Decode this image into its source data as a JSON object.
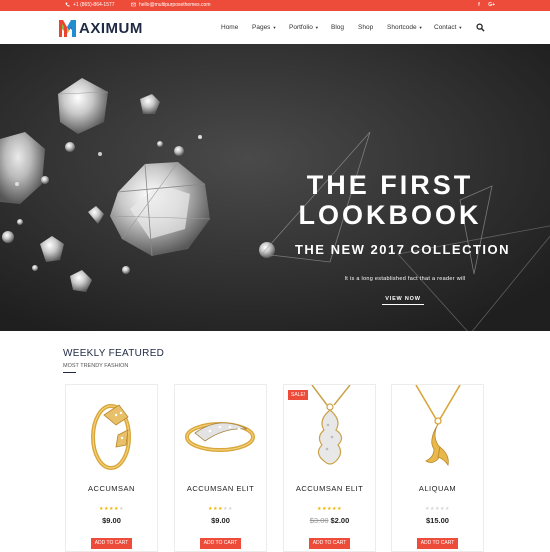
{
  "topbar": {
    "phone": "+1 (865)-864-1577",
    "email": "hello@multipurposethemes.com",
    "social": [
      "f",
      "G+"
    ]
  },
  "header": {
    "logo_text": "AXIMUM",
    "nav": [
      {
        "label": "Home"
      },
      {
        "label": "Pages"
      },
      {
        "label": "Portfolio"
      },
      {
        "label": "Blog"
      },
      {
        "label": "Shop"
      },
      {
        "label": "Shortcode"
      },
      {
        "label": "Contact"
      }
    ]
  },
  "hero": {
    "title": "THE FIRST LOOKBOOK",
    "subtitle": "THE NEW 2017 COLLECTION",
    "description": "It is a long established fact that a reader will",
    "button": "VIEW NOW"
  },
  "featured": {
    "title": "WEEKLY FEATURED",
    "subtitle": "MOST TRENDY FASHION",
    "products": [
      {
        "name": "ACCUMSAN",
        "price": "$9.00",
        "old_price": "",
        "rating": 4,
        "sale": "",
        "button": "ADD TO CART"
      },
      {
        "name": "ACCUMSAN ELIT",
        "price": "$9.00",
        "old_price": "",
        "rating": 3,
        "sale": "",
        "button": "ADD TO CART"
      },
      {
        "name": "ACCUMSAN ELIT",
        "price": "$2.00",
        "old_price": "$3.00",
        "rating": 5,
        "sale": "SALE!",
        "button": "ADD TO CART"
      },
      {
        "name": "ALIQUAM",
        "price": "$15.00",
        "old_price": "",
        "rating": 0,
        "sale": "",
        "button": "ADD TO CART"
      }
    ]
  },
  "colors": {
    "accent": "#ee4c3a",
    "navy": "#1f2a44",
    "star": "#f0b400"
  }
}
